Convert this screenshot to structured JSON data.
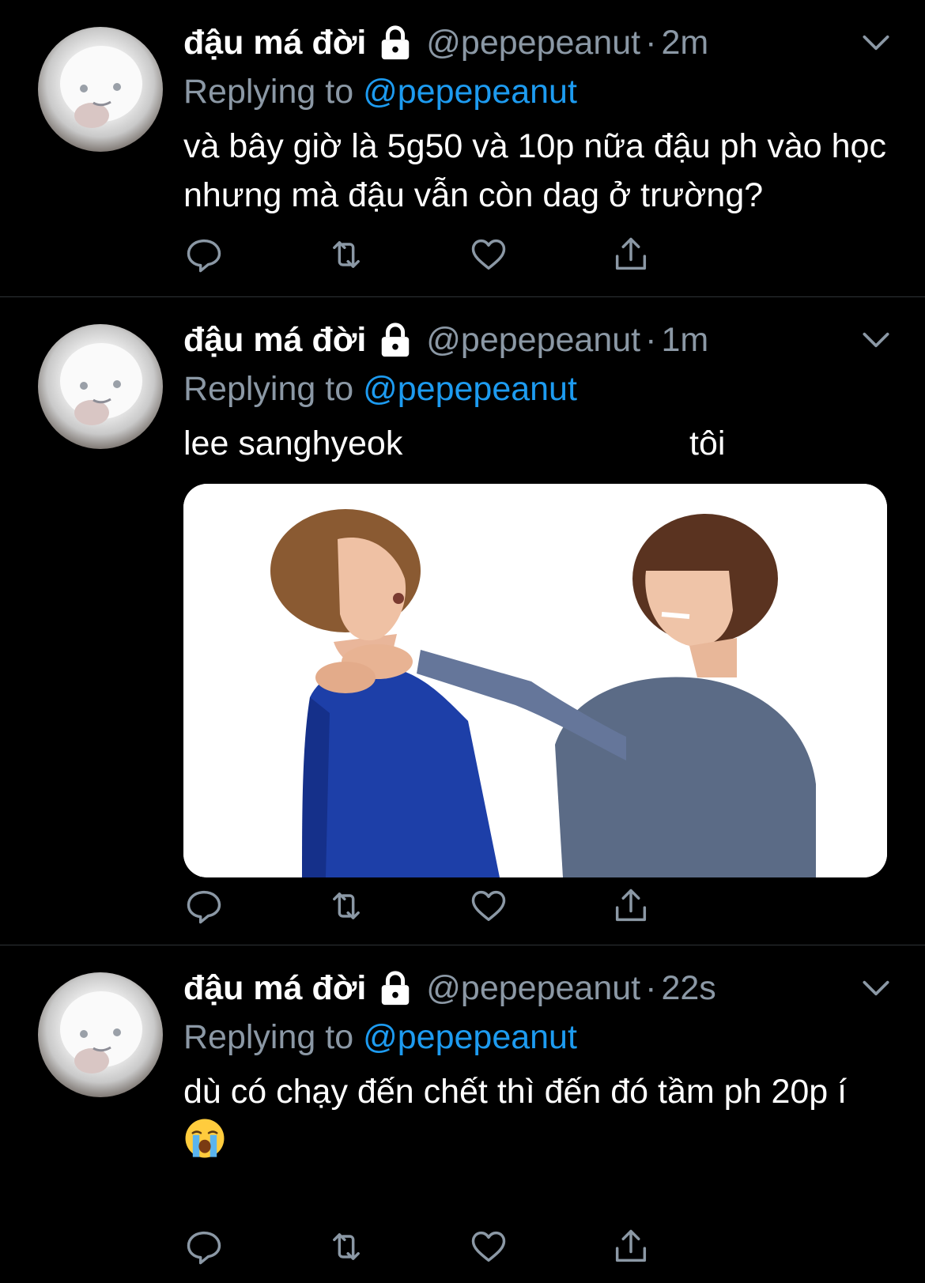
{
  "theme": {
    "background": "#000000",
    "text": "#ffffff",
    "secondary_text": "#8b98a5",
    "accent": "#1d9bf0",
    "divider": "#2f3336"
  },
  "tweets": [
    {
      "display_name": "đậu má đời",
      "protected_icon": "lock-icon",
      "handle": "@pepepeanut",
      "separator": "·",
      "time": "2m",
      "reply_prefix": "Replying to",
      "reply_to": "@pepepeanut",
      "text": "và bây giờ là 5g50 và 10p nữa đậu ph vào học nhưng mà đậu vẫn còn dag ở trường?"
    },
    {
      "display_name": "đậu má đời",
      "protected_icon": "lock-icon",
      "handle": "@pepepeanut",
      "separator": "·",
      "time": "1m",
      "reply_prefix": "Replying to",
      "reply_to": "@pepepeanut",
      "text_left": "lee sanghyeok",
      "text_right": "tôi",
      "media": "photo of one man grabbing another man by the neck"
    },
    {
      "display_name": "đậu má đời",
      "protected_icon": "lock-icon",
      "handle": "@pepepeanut",
      "separator": "·",
      "time": "22s",
      "reply_prefix": "Replying to",
      "reply_to": "@pepepeanut",
      "text": "dù có chạy đến chết thì đến đó tầm ph 20p í",
      "emoji": "loudly-crying-face"
    }
  ],
  "actions": [
    "reply-icon",
    "retweet-icon",
    "like-icon",
    "share-icon"
  ]
}
